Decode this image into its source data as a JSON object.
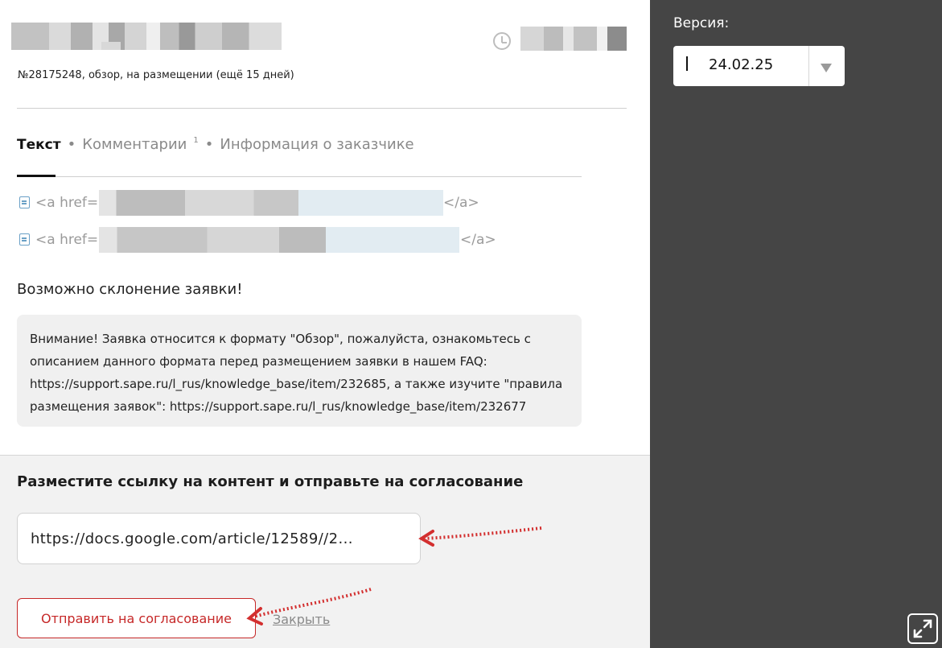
{
  "task": {
    "meta": "№28175248, обзор, на размещении (ещё 15 дней)"
  },
  "tabs": [
    {
      "label": "Текст",
      "active": true
    },
    {
      "label": "Комментарии",
      "badge": "1"
    },
    {
      "label": "Информация о заказчике"
    }
  ],
  "links": [
    {
      "prefix": "<a href=\"",
      "suffix": "</a>"
    },
    {
      "prefix": "<a href=\"",
      "suffix": "</a>"
    }
  ],
  "warning": {
    "title": "Возможно склонение заявки!",
    "notice": "Внимание! Заявка относится к формату \"Обзор\", пожалуйста, ознакомьтесь с описанием данного формата перед размещением заявки в нашем FAQ: https://support.sape.ru/l_rus/knowledge_base/item/232685, а также изучите \"правила размещения заявок\": https://support.sape.ru/l_rus/knowledge_base/item/232677"
  },
  "submit": {
    "title": "Разместите ссылку на контент и отправьте на согласование",
    "url_value": "https://docs.google.com/article/12589//2...",
    "send_label": "Отправить на согласование",
    "close_label": "Закрыть"
  },
  "sidebar": {
    "version_label": "Версия:",
    "version_value": "24.02.25"
  },
  "colors": {
    "accent": "#c62828",
    "sidebar_bg": "#454545",
    "panel_bg": "#f2f2f2"
  },
  "icons": [
    "clock-icon",
    "document-icon",
    "chevron-down-icon",
    "expand-icon"
  ]
}
